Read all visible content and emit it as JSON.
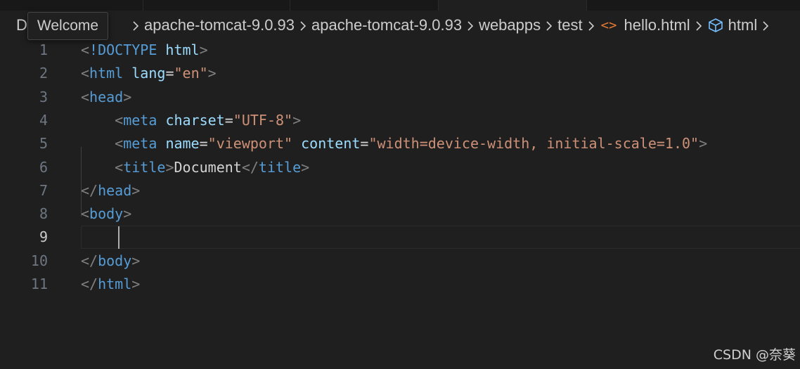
{
  "breadcrumb": {
    "first": "D",
    "items": [
      {
        "label": "apache-tomcat-9.0.93",
        "icon": "chevron-right-icon"
      },
      {
        "label": "apache-tomcat-9.0.93",
        "icon": "chevron-right-icon"
      },
      {
        "label": "webapps",
        "icon": "chevron-right-icon"
      },
      {
        "label": "test",
        "icon": "chevron-right-icon"
      }
    ],
    "file_icon_glyph": "<>",
    "file_icon": "html-file-icon",
    "file": "hello.html",
    "symbol_icon": "cube-symbol-icon",
    "symbol": "html"
  },
  "tooltip": {
    "text": "Welcome"
  },
  "editor": {
    "active_line": 9,
    "lines": [
      {
        "n": "1",
        "tokens": [
          [
            "b",
            "<"
          ],
          [
            "t",
            "!DOCTYPE"
          ],
          [
            "x",
            " "
          ],
          [
            "a",
            "html"
          ],
          [
            "b",
            ">"
          ]
        ]
      },
      {
        "n": "2",
        "tokens": [
          [
            "b",
            "<"
          ],
          [
            "t",
            "html"
          ],
          [
            "x",
            " "
          ],
          [
            "a",
            "lang"
          ],
          [
            "x",
            "="
          ],
          [
            "s",
            "\"en\""
          ],
          [
            "b",
            ">"
          ]
        ]
      },
      {
        "n": "3",
        "tokens": [
          [
            "b",
            "<"
          ],
          [
            "t",
            "head"
          ],
          [
            "b",
            ">"
          ]
        ]
      },
      {
        "n": "4",
        "tokens": [
          [
            "x",
            "    "
          ],
          [
            "b",
            "<"
          ],
          [
            "t",
            "meta"
          ],
          [
            "x",
            " "
          ],
          [
            "a",
            "charset"
          ],
          [
            "x",
            "="
          ],
          [
            "s",
            "\"UTF-8\""
          ],
          [
            "b",
            ">"
          ]
        ]
      },
      {
        "n": "5",
        "tokens": [
          [
            "x",
            "    "
          ],
          [
            "b",
            "<"
          ],
          [
            "t",
            "meta"
          ],
          [
            "x",
            " "
          ],
          [
            "a",
            "name"
          ],
          [
            "x",
            "="
          ],
          [
            "s",
            "\"viewport\""
          ],
          [
            "x",
            " "
          ],
          [
            "a",
            "content"
          ],
          [
            "x",
            "="
          ],
          [
            "s",
            "\"width=device-width, initial-scale=1.0\""
          ],
          [
            "b",
            ">"
          ]
        ]
      },
      {
        "n": "6",
        "tokens": [
          [
            "x",
            "    "
          ],
          [
            "b",
            "<"
          ],
          [
            "t",
            "title"
          ],
          [
            "b",
            ">"
          ],
          [
            "x",
            "Document"
          ],
          [
            "b",
            "</"
          ],
          [
            "t",
            "title"
          ],
          [
            "b",
            ">"
          ]
        ]
      },
      {
        "n": "7",
        "tokens": [
          [
            "b",
            "</"
          ],
          [
            "t",
            "head"
          ],
          [
            "b",
            ">"
          ]
        ]
      },
      {
        "n": "8",
        "tokens": [
          [
            "b",
            "<"
          ],
          [
            "t",
            "body"
          ],
          [
            "b",
            ">"
          ]
        ]
      },
      {
        "n": "9",
        "tokens": []
      },
      {
        "n": "10",
        "tokens": [
          [
            "b",
            "</"
          ],
          [
            "t",
            "body"
          ],
          [
            "b",
            ">"
          ]
        ]
      },
      {
        "n": "11",
        "tokens": [
          [
            "b",
            "</"
          ],
          [
            "t",
            "html"
          ],
          [
            "b",
            ">"
          ]
        ]
      }
    ]
  },
  "watermark": "CSDN @奈葵"
}
